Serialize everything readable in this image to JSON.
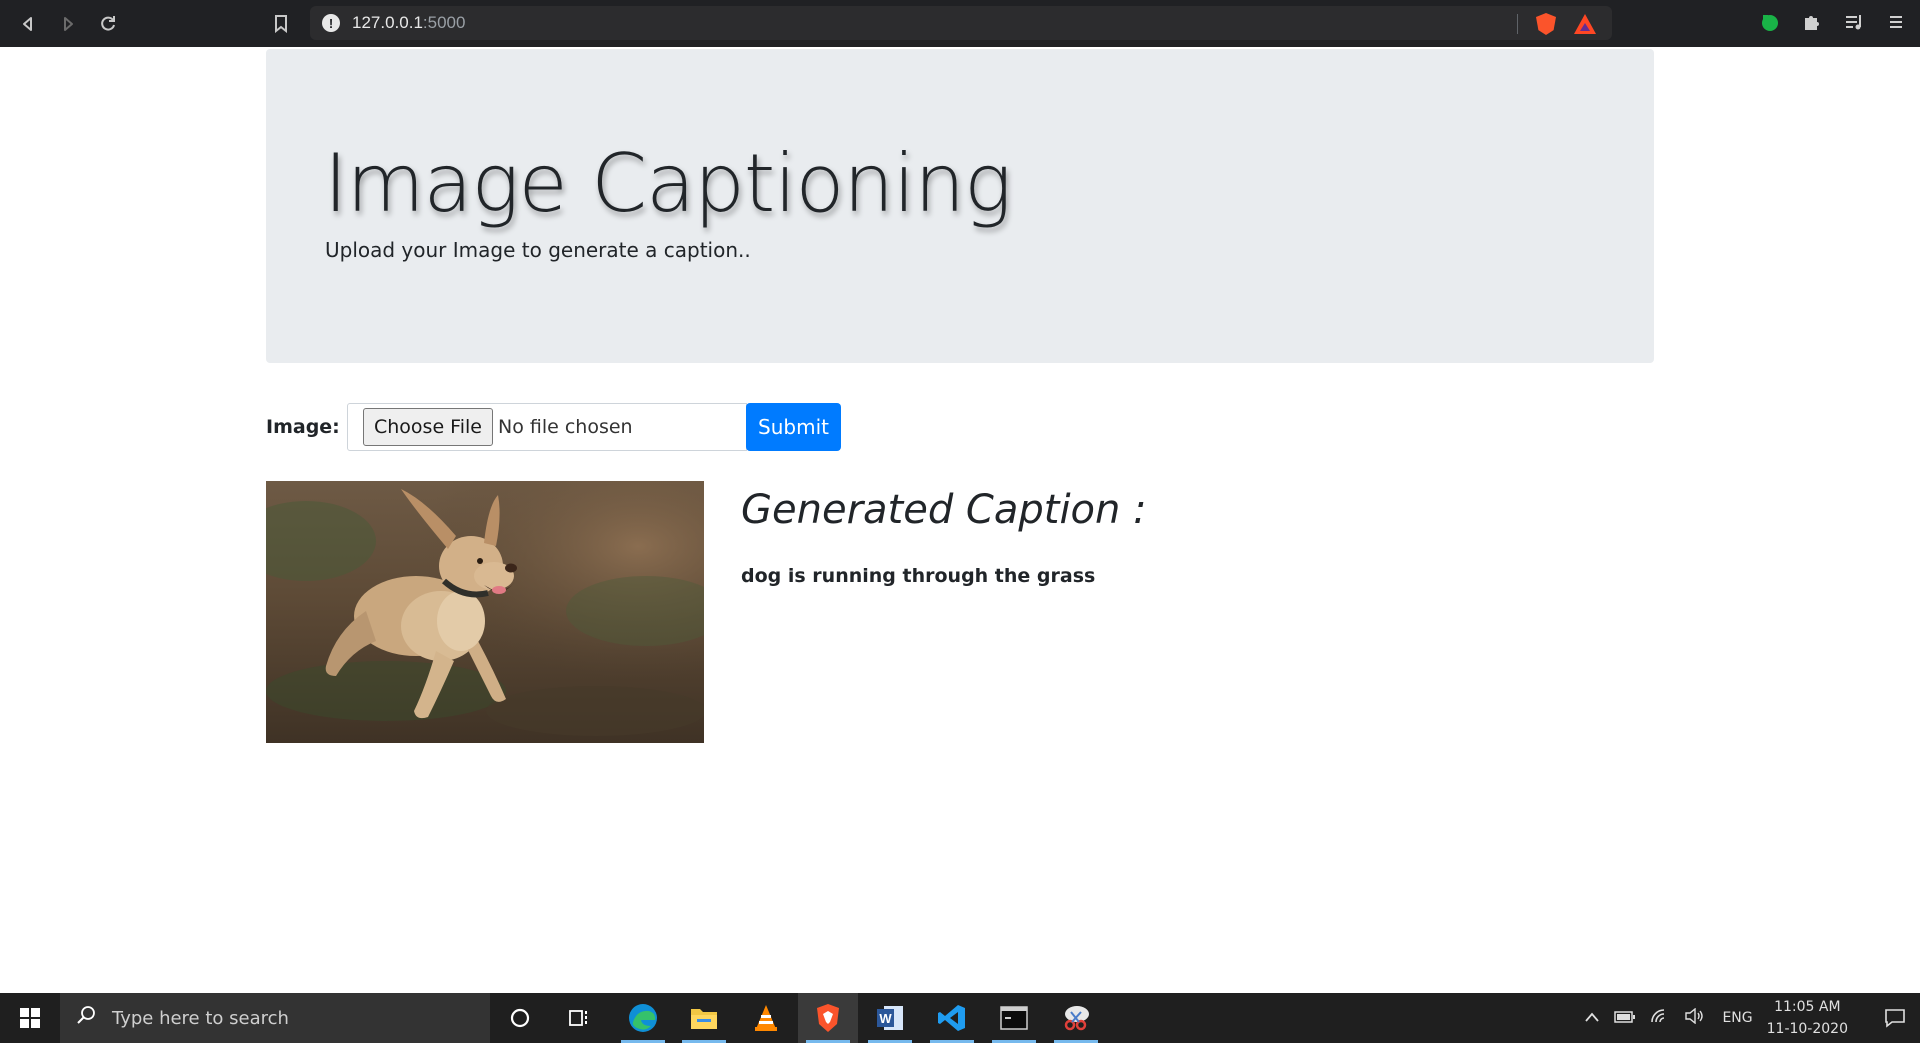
{
  "browser": {
    "url_host": "127.0.0.1",
    "url_port": ":5000"
  },
  "page": {
    "title": "Image Captioning",
    "subtitle": "Upload your Image to generate a caption..",
    "form": {
      "label": "Image:",
      "choose_file_label": "Choose File",
      "no_file_text": "No file chosen",
      "submit_label": "Submit"
    },
    "result": {
      "heading": "Generated Caption :",
      "caption": "dog is running through the grass"
    }
  },
  "taskbar": {
    "search_placeholder": "Type here to search",
    "language": "ENG",
    "time": "11:05 AM",
    "date": "11-10-2020"
  },
  "colors": {
    "chrome_bg": "#202124",
    "jumbotron_bg": "#e9ecef",
    "submit_bg": "#007bff",
    "taskbar_bg": "#1f1f1f"
  }
}
